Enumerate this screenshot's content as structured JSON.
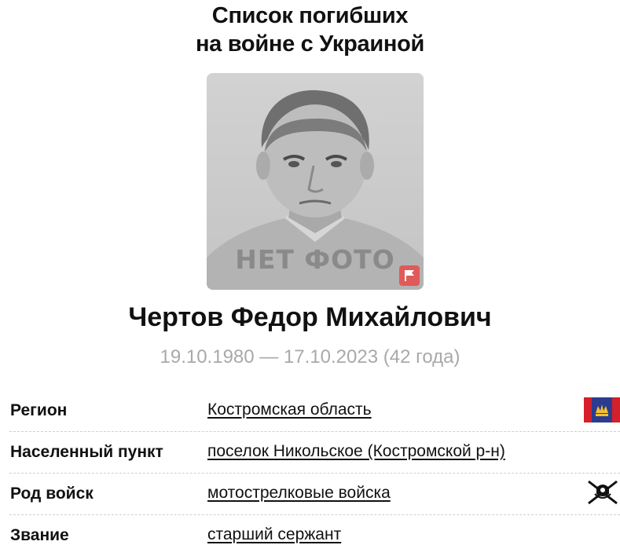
{
  "header": {
    "title_line1": "Список погибших",
    "title_line2": "на войне с Украиной"
  },
  "photo": {
    "placeholder_text": "НЕТ ФОТО",
    "flag_icon": "flag-icon"
  },
  "person": {
    "name": "Чертов Федор Михайлович",
    "dates": "19.10.1980 — 17.10.2023 (42 года)"
  },
  "details": [
    {
      "label": "Регион",
      "value": "Костромская область",
      "icon": "region-flag-icon"
    },
    {
      "label": "Населенный пункт",
      "value": "поселок Никольское (Костромской р-н)",
      "icon": ""
    },
    {
      "label": "Род войск",
      "value": "мотострелковые войска",
      "icon": "motor-rifle-emblem-icon"
    },
    {
      "label": "Звание",
      "value": "старший сержант",
      "icon": ""
    }
  ],
  "colors": {
    "badge": "#e05a5a",
    "dates_text": "#a9a9a9",
    "region_flag_red": "#d3202a",
    "region_flag_blue": "#2b3c8f",
    "region_flag_gold": "#f2c12e"
  }
}
